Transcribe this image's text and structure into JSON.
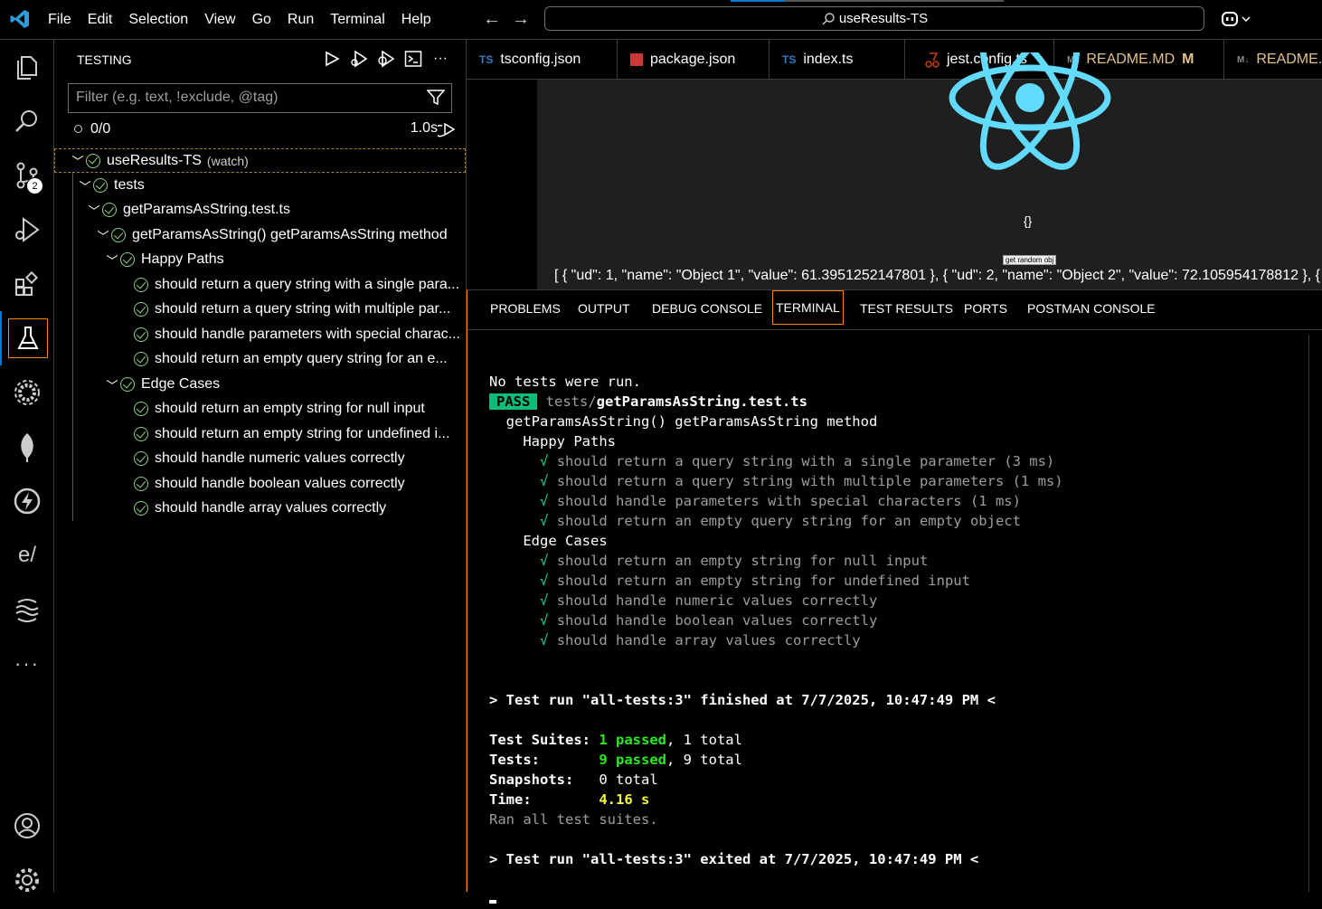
{
  "menu": [
    "File",
    "Edit",
    "Selection",
    "View",
    "Go",
    "Run",
    "Terminal",
    "Help"
  ],
  "search_text": "useResults-TS",
  "sidebar": {
    "title": "TESTING",
    "filter_placeholder": "Filter (e.g. text, !exclude, @tag)",
    "count": "0/0",
    "duration": "1.0s",
    "badge": "2"
  },
  "tree": {
    "root": "useResults-TS",
    "root_tag": "(watch)",
    "folder": "tests",
    "file": "getParamsAsString.test.ts",
    "describe": "getParamsAsString() getParamsAsString method",
    "group1": "Happy Paths",
    "group1_items": [
      "should return a query string with a single para...",
      "should return a query string with multiple par...",
      "should handle parameters with special charac...",
      "should return an empty query string for an e..."
    ],
    "group2": "Edge Cases",
    "group2_items": [
      "should return an empty string for null input",
      "should return an empty string for undefined i...",
      "should handle numeric values correctly",
      "should handle boolean values correctly",
      "should handle array values correctly"
    ]
  },
  "tabs": [
    {
      "icon": "TS",
      "label": "tsconfig.json",
      "color": "#3178c6"
    },
    {
      "icon": "npm",
      "label": "package.json",
      "color": "#cb3837"
    },
    {
      "icon": "TS",
      "label": "index.ts",
      "color": "#3178c6"
    },
    {
      "icon": "jest",
      "label": "jest.config.ts",
      "color": "#c63d14"
    },
    {
      "icon": "M↓",
      "label": "README.MD",
      "status": "M",
      "color": "#e2c08d"
    },
    {
      "icon": "M↓",
      "label": "README.I",
      "color": "#e2c08d"
    }
  ],
  "preview": {
    "braces": "{}",
    "button": "get random obj",
    "json": "[ { \"ud\": 1, \"name\": \"Object 1\", \"value\": 61.3951252147801 }, { \"ud\": 2, \"name\": \"Object 2\", \"value\": 72.105954178812 }, {"
  },
  "panel_tabs": [
    "PROBLEMS",
    "OUTPUT",
    "DEBUG CONSOLE",
    "TERMINAL",
    "TEST RESULTS",
    "PORTS",
    "POSTMAN CONSOLE"
  ],
  "terminal": {
    "no_tests": "No tests were run.",
    "pass": "PASS",
    "path_dir": "tests/",
    "path_file": "getParamsAsString.test.ts",
    "describe": "getParamsAsString() getParamsAsString method",
    "group1": "Happy Paths",
    "group1_items": [
      "should return a query string with a single parameter (3 ms)",
      "should return a query string with multiple parameters (1 ms)",
      "should handle parameters with special characters (1 ms)",
      "should return an empty query string for an empty object"
    ],
    "group2": "Edge Cases",
    "group2_items": [
      "should return an empty string for null input",
      "should return an empty string for undefined input",
      "should handle numeric values correctly",
      "should handle boolean values correctly",
      "should handle array values correctly"
    ],
    "finished": "> Test run \"all-tests:3\" finished at 7/7/2025, 10:47:49 PM <",
    "suites_label": "Test Suites:",
    "suites_passed": "1 passed",
    "suites_total": ", 1 total",
    "tests_label": "Tests:",
    "tests_passed": "9 passed",
    "tests_total": ", 9 total",
    "snap_label": "Snapshots:",
    "snap_total": "0 total",
    "time_label": "Time:",
    "time_value": "4.16 s",
    "ran_all": "Ran all test suites.",
    "exited": "> Test run \"all-tests:3\" exited at 7/7/2025, 10:47:49 PM <"
  }
}
